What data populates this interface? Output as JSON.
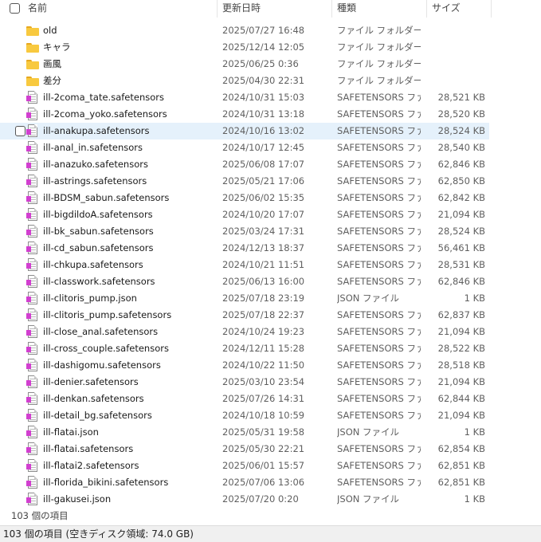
{
  "header": {
    "name_label": "名前",
    "date_label": "更新日時",
    "type_label": "種類",
    "size_label": "サイズ"
  },
  "files": [
    {
      "name": "old",
      "date": "2025/07/27 16:48",
      "type": "ファイル フォルダー",
      "size": "",
      "icon": "folder-icon"
    },
    {
      "name": "キャラ",
      "date": "2025/12/14 12:05",
      "type": "ファイル フォルダー",
      "size": "",
      "icon": "folder-icon"
    },
    {
      "name": "画風",
      "date": "2025/06/25 0:36",
      "type": "ファイル フォルダー",
      "size": "",
      "icon": "folder-icon"
    },
    {
      "name": "差分",
      "date": "2025/04/30 22:31",
      "type": "ファイル フォルダー",
      "size": "",
      "icon": "folder-icon"
    },
    {
      "name": "ill-2coma_tate.safetensors",
      "date": "2024/10/31 15:03",
      "type": "SAFETENSORS ファ...",
      "size": "28,521 KB",
      "icon": "file-icon"
    },
    {
      "name": "ill-2coma_yoko.safetensors",
      "date": "2024/10/31 13:18",
      "type": "SAFETENSORS ファ...",
      "size": "28,520 KB",
      "icon": "file-icon"
    },
    {
      "name": "ill-anakupa.safetensors",
      "date": "2024/10/16 13:02",
      "type": "SAFETENSORS ファ...",
      "size": "28,524 KB",
      "icon": "file-icon",
      "hover": true
    },
    {
      "name": "ill-anal_in.safetensors",
      "date": "2024/10/17 12:45",
      "type": "SAFETENSORS ファ...",
      "size": "28,540 KB",
      "icon": "file-icon"
    },
    {
      "name": "ill-anazuko.safetensors",
      "date": "2025/06/08 17:07",
      "type": "SAFETENSORS ファ...",
      "size": "62,846 KB",
      "icon": "file-icon"
    },
    {
      "name": "ill-astrings.safetensors",
      "date": "2025/05/21 17:06",
      "type": "SAFETENSORS ファ...",
      "size": "62,850 KB",
      "icon": "file-icon"
    },
    {
      "name": "ill-BDSM_sabun.safetensors",
      "date": "2025/06/02 15:35",
      "type": "SAFETENSORS ファ...",
      "size": "62,842 KB",
      "icon": "file-icon"
    },
    {
      "name": "ill-bigdildoA.safetensors",
      "date": "2024/10/20 17:07",
      "type": "SAFETENSORS ファ...",
      "size": "21,094 KB",
      "icon": "file-icon"
    },
    {
      "name": "ill-bk_sabun.safetensors",
      "date": "2025/03/24 17:31",
      "type": "SAFETENSORS ファ...",
      "size": "28,524 KB",
      "icon": "file-icon"
    },
    {
      "name": "ill-cd_sabun.safetensors",
      "date": "2024/12/13 18:37",
      "type": "SAFETENSORS ファ...",
      "size": "56,461 KB",
      "icon": "file-icon"
    },
    {
      "name": "ill-chkupa.safetensors",
      "date": "2024/10/21 11:51",
      "type": "SAFETENSORS ファ...",
      "size": "28,531 KB",
      "icon": "file-icon"
    },
    {
      "name": "ill-classwork.safetensors",
      "date": "2025/06/13 16:00",
      "type": "SAFETENSORS ファ...",
      "size": "62,846 KB",
      "icon": "file-icon"
    },
    {
      "name": "ill-clitoris_pump.json",
      "date": "2025/07/18 23:19",
      "type": "JSON ファイル",
      "size": "1 KB",
      "icon": "file-icon"
    },
    {
      "name": "ill-clitoris_pump.safetensors",
      "date": "2025/07/18 22:37",
      "type": "SAFETENSORS ファ...",
      "size": "62,837 KB",
      "icon": "file-icon"
    },
    {
      "name": "ill-close_anal.safetensors",
      "date": "2024/10/24 19:23",
      "type": "SAFETENSORS ファ...",
      "size": "21,094 KB",
      "icon": "file-icon"
    },
    {
      "name": "ill-cross_couple.safetensors",
      "date": "2024/12/11 15:28",
      "type": "SAFETENSORS ファ...",
      "size": "28,522 KB",
      "icon": "file-icon"
    },
    {
      "name": "ill-dashigomu.safetensors",
      "date": "2024/10/22 11:50",
      "type": "SAFETENSORS ファ...",
      "size": "28,518 KB",
      "icon": "file-icon"
    },
    {
      "name": "ill-denier.safetensors",
      "date": "2025/03/10 23:54",
      "type": "SAFETENSORS ファ...",
      "size": "21,094 KB",
      "icon": "file-icon"
    },
    {
      "name": "ill-denkan.safetensors",
      "date": "2025/07/26 14:31",
      "type": "SAFETENSORS ファ...",
      "size": "62,844 KB",
      "icon": "file-icon"
    },
    {
      "name": "ill-detail_bg.safetensors",
      "date": "2024/10/18 10:59",
      "type": "SAFETENSORS ファ...",
      "size": "21,094 KB",
      "icon": "file-icon"
    },
    {
      "name": "ill-flatai.json",
      "date": "2025/05/31 19:58",
      "type": "JSON ファイル",
      "size": "1 KB",
      "icon": "file-icon"
    },
    {
      "name": "ill-flatai.safetensors",
      "date": "2025/05/30 22:21",
      "type": "SAFETENSORS ファ...",
      "size": "62,854 KB",
      "icon": "file-icon"
    },
    {
      "name": "ill-flatai2.safetensors",
      "date": "2025/06/01 15:57",
      "type": "SAFETENSORS ファ...",
      "size": "62,851 KB",
      "icon": "file-icon"
    },
    {
      "name": "ill-florida_bikini.safetensors",
      "date": "2025/07/06 13:06",
      "type": "SAFETENSORS ファ...",
      "size": "62,851 KB",
      "icon": "file-icon"
    },
    {
      "name": "ill-gakusei.json",
      "date": "2025/07/20 0:20",
      "type": "JSON ファイル",
      "size": "1 KB",
      "icon": "file-icon"
    }
  ],
  "footer": {
    "item_count": "103 個の項目"
  },
  "status_bar": {
    "text": "103 個の項目 (空きディスク領域: 74.0 GB)"
  }
}
